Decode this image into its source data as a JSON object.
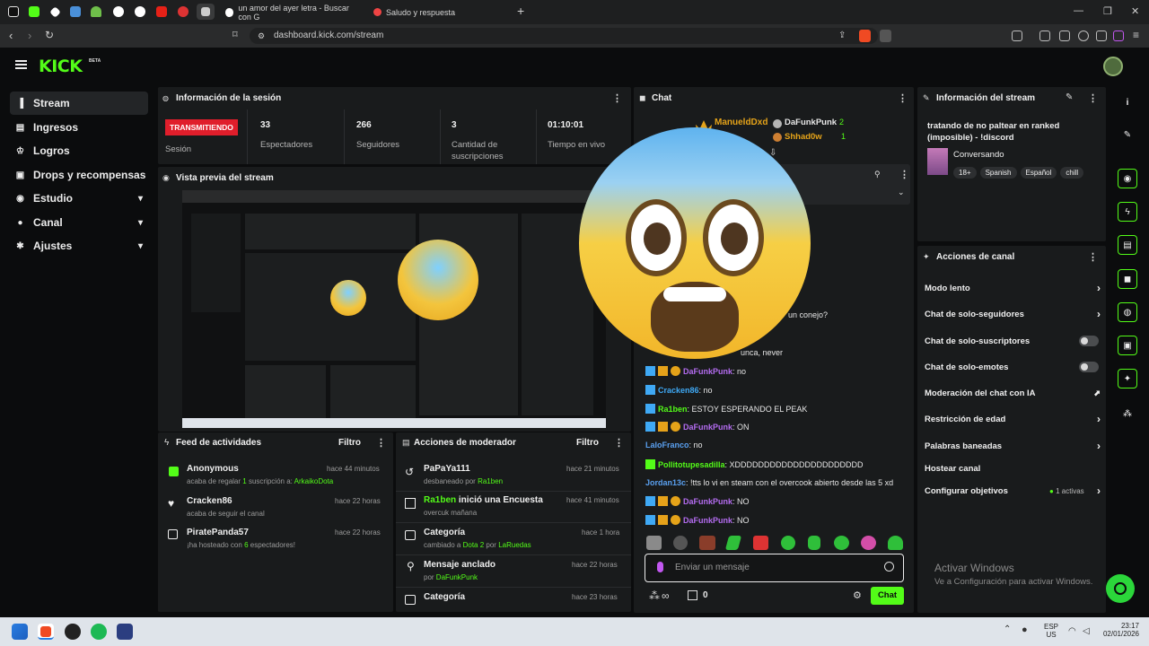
{
  "browser": {
    "tabs": [
      {
        "label": "un amor del ayer letra - Buscar con G"
      },
      {
        "label": "Saludo y respuesta"
      }
    ],
    "new_tab": "+",
    "url": "dashboard.kick.com/stream",
    "window_controls": {
      "minimize": "—",
      "restore": "❐",
      "close": "✕"
    }
  },
  "header": {
    "logo": "KICK",
    "logo_badge": "BETA"
  },
  "sidebar": {
    "items": [
      {
        "label": "Stream",
        "icon": "stream-icon",
        "active": true
      },
      {
        "label": "Ingresos",
        "icon": "money-icon"
      },
      {
        "label": "Logros",
        "icon": "trophy-icon"
      },
      {
        "label": "Drops y recompensas",
        "icon": "gift-icon"
      },
      {
        "label": "Estudio",
        "icon": "studio-icon",
        "expandable": true
      },
      {
        "label": "Canal",
        "icon": "user-icon",
        "expandable": true
      },
      {
        "label": "Ajustes",
        "icon": "gear-icon",
        "expandable": true
      }
    ]
  },
  "session": {
    "title": "Información de la sesión",
    "live_badge": "TRANSMITIENDO",
    "live_label": "Sesión",
    "stats": [
      {
        "value": "33",
        "label": "Espectadores"
      },
      {
        "value": "266",
        "label": "Seguidores"
      },
      {
        "value": "3",
        "label": "Cantidad de suscripciones"
      },
      {
        "value": "01:10:01",
        "label": "Tiempo en vivo"
      }
    ]
  },
  "preview": {
    "title": "Vista previa del stream"
  },
  "activity": {
    "title": "Feed de actividades",
    "filter": "Filtro",
    "items": [
      {
        "name": "Anonymous",
        "time": "hace 44 minutos",
        "pre": "acaba de regalar",
        "num": "1",
        "mid": "suscripción a:",
        "target": "ArkaikoDota"
      },
      {
        "name": "Cracken86",
        "time": "hace 22 horas",
        "pre": "acaba de seguir el canal"
      },
      {
        "name": "PiratePanda57",
        "time": "hace 22 horas",
        "pre": "¡ha hosteado con",
        "num": "6",
        "mid": "espectadores!"
      }
    ]
  },
  "mod_actions": {
    "title": "Acciones de moderador",
    "filter": "Filtro",
    "items": [
      {
        "title": "PaPaYa111",
        "time": "hace 21 minutos",
        "sub": "desbaneado por",
        "by": "Ra1ben"
      },
      {
        "title_green": "Ra1ben",
        "title": " inició una Encuesta",
        "time": "hace 41 minutos",
        "sub": "overcuk mañana"
      },
      {
        "title": "Categoría",
        "time": "hace 1 hora",
        "sub": "cambiado a",
        "target": "Dota 2",
        "sub2": "por",
        "by": "LaRuedas"
      },
      {
        "title": "Mensaje anclado",
        "time": "hace 22 horas",
        "sub": "por",
        "by": "DaFunkPunk"
      },
      {
        "title": "Categoría",
        "time": "hace 23 horas"
      }
    ]
  },
  "chat": {
    "title": "Chat",
    "top_gifters": [
      {
        "name": "ManueldDxd",
        "count": "5"
      },
      {
        "name": "DaFunkPunk",
        "count": "2"
      },
      {
        "name": "Shhad0w",
        "count": "1"
      }
    ],
    "partial_lines": [
      {
        "text": "un conejo?"
      },
      {
        "text": "unca, never"
      }
    ],
    "messages": [
      {
        "user": "DaFunkPunk",
        "text": ": no",
        "badges": "kco",
        "color": "#b46cf0"
      },
      {
        "user": "Cracken86",
        "text": ": no",
        "badges": "k",
        "color": "#3fa9f5"
      },
      {
        "user": "Ra1ben",
        "text": ": ESTOY ESPERANDO EL PEAK",
        "badges": "k",
        "color": "#53fc18"
      },
      {
        "user": "DaFunkPunk",
        "text": ": ON",
        "badges": "kco",
        "color": "#b46cf0"
      },
      {
        "user": "LaloFranco",
        "text": ": no",
        "badges": "",
        "color": "#5aa0f0"
      },
      {
        "user": "Pollitotupesadilla",
        "text": ": XDDDDDDDDDDDDDDDDDDDDDD",
        "badges": "g",
        "color": "#53fc18"
      },
      {
        "user": "Jordan13c",
        "text": ": !tts lo vi en steam con el overcook abierto desde las 5 xd",
        "badges": "",
        "color": "#5aa0f0"
      },
      {
        "user": "DaFunkPunk",
        "text": ": NO",
        "badges": "kco",
        "color": "#b46cf0"
      },
      {
        "user": "DaFunkPunk",
        "text": ": NO",
        "badges": "kco",
        "color": "#b46cf0"
      }
    ],
    "input_placeholder": "Enviar un mensaje",
    "points": "0",
    "send_button": "Chat"
  },
  "stream_info": {
    "title": "Información del stream",
    "stream_title": "tratando de no paltear en ranked (imposible) - !discord",
    "category": "Conversando",
    "tags": [
      "18+",
      "Spanish",
      "Español",
      "chill"
    ]
  },
  "channel_actions": {
    "title": "Acciones de canal",
    "items": [
      {
        "label": "Modo lento",
        "control": "chevron"
      },
      {
        "label": "Chat de solo-seguidores",
        "control": "chevron"
      },
      {
        "label": "Chat de solo-suscriptores",
        "control": "toggle"
      },
      {
        "label": "Chat de solo-emotes",
        "control": "toggle"
      },
      {
        "label": "Moderación del chat con IA",
        "control": "external"
      },
      {
        "label": "Restricción de edad",
        "control": "chevron"
      },
      {
        "label": "Palabras baneadas",
        "control": "chevron"
      },
      {
        "label": "Hostear canal",
        "control": "none"
      },
      {
        "label": "Configurar objetivos",
        "control": "chevron",
        "extra": "1 activas"
      }
    ]
  },
  "watermark": {
    "line1": "Activar Windows",
    "line2": "Ve a Configuración para activar Windows."
  },
  "taskbar": {
    "lang1": "ESP",
    "lang2": "US",
    "time": "23:17",
    "date": "02/01/2026"
  },
  "colors": {
    "accent": "#53fc18",
    "live": "#e01e2b",
    "panel": "#191b1c",
    "bg": "#0b0c0d"
  }
}
